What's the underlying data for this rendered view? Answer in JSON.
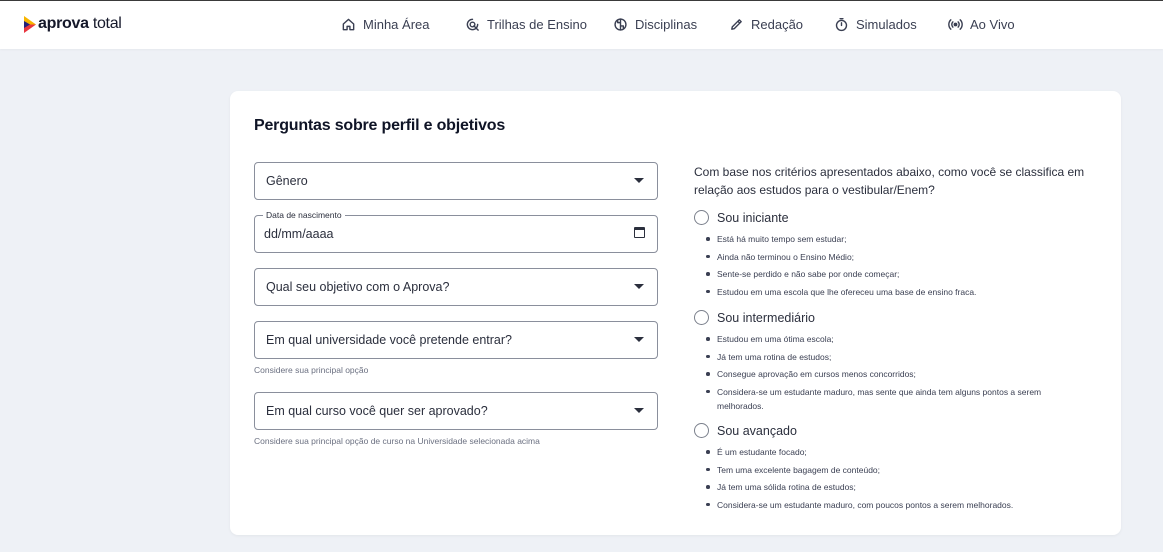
{
  "brand": {
    "name_bold": "aprova",
    "name_light": " total",
    "colors": {
      "yellow": "#f7b500",
      "red": "#e8363f",
      "navy": "#23217a"
    }
  },
  "nav": [
    {
      "label": "Minha Área",
      "icon": "home-icon"
    },
    {
      "label": "Trilhas de Ensino",
      "icon": "route-icon"
    },
    {
      "label": "Disciplinas",
      "icon": "brain-icon"
    },
    {
      "label": "Redação",
      "icon": "pencil-icon"
    },
    {
      "label": "Simulados",
      "icon": "stopwatch-icon"
    },
    {
      "label": "Ao Vivo",
      "icon": "broadcast-icon"
    }
  ],
  "form": {
    "title": "Perguntas sobre perfil e objetivos",
    "gender": {
      "value": "Gênero"
    },
    "birthdate": {
      "legend": "Data de nascimento",
      "value": "dd/mm/aaaa"
    },
    "goal": {
      "value": "Qual seu objetivo com o Aprova?"
    },
    "university": {
      "value": "Em qual universidade você pretende entrar?",
      "helper": "Considere sua principal opção"
    },
    "course": {
      "value": "Em qual curso você quer ser aprovado?",
      "helper": "Considere sua principal opção de curso na Universidade selecionada acima"
    }
  },
  "classification": {
    "question": "Com base nos critérios apresentados abaixo, como você se classifica em relação aos estudos para o vestibular/Enem?",
    "options": [
      {
        "label": "Sou iniciante",
        "bullets": [
          "Está há muito tempo sem estudar;",
          "Ainda não terminou o Ensino Médio;",
          "Sente-se perdido e não sabe por onde começar;",
          "Estudou em uma escola que lhe ofereceu uma base de ensino fraca."
        ]
      },
      {
        "label": "Sou intermediário",
        "bullets": [
          "Estudou em uma ótima escola;",
          "Já tem uma rotina de estudos;",
          "Consegue aprovação em cursos menos concorridos;",
          "Considera-se um estudante maduro, mas sente que ainda tem alguns pontos a serem melhorados."
        ]
      },
      {
        "label": "Sou avançado",
        "bullets": [
          "É um estudante focado;",
          "Tem uma excelente bagagem de conteúdo;",
          "Já tem uma sólida rotina de estudos;",
          "Considera-se um estudante maduro, com poucos pontos a serem melhorados."
        ]
      }
    ]
  }
}
